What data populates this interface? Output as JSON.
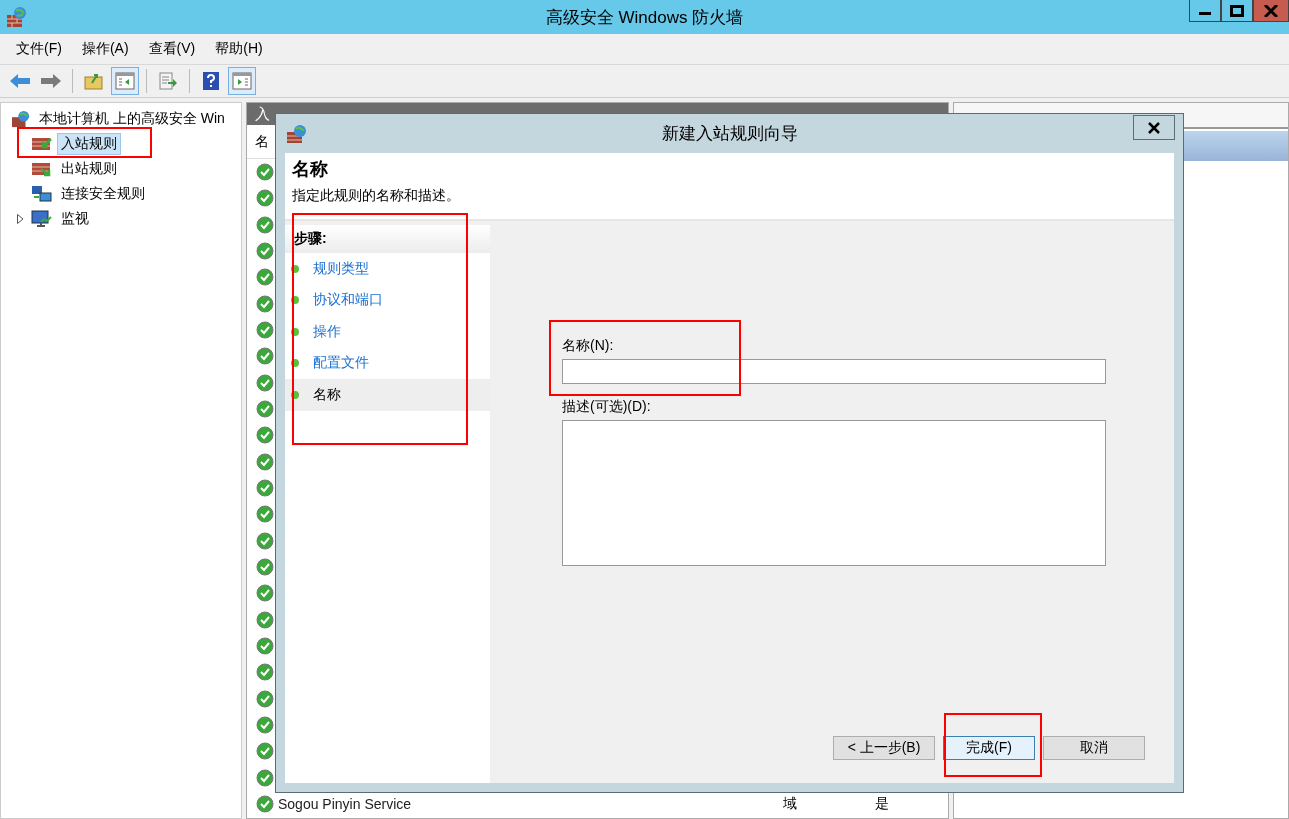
{
  "window": {
    "title": "高级安全 Windows 防火墙"
  },
  "menu": [
    "文件(F)",
    "操作(A)",
    "查看(V)",
    "帮助(H)"
  ],
  "toolbar": [
    {
      "kind": "back",
      "pressed": false
    },
    {
      "kind": "forward",
      "pressed": false
    },
    {
      "kind": "up",
      "pressed": false
    },
    {
      "kind": "tree",
      "pressed": true
    },
    {
      "kind": "export",
      "pressed": false
    },
    {
      "kind": "help",
      "pressed": false
    },
    {
      "kind": "pane",
      "pressed": true
    }
  ],
  "tree": {
    "root": "本地计算机 上的高级安全 Win",
    "children": [
      {
        "label": "入站规则",
        "kind": "inbound",
        "selected": true
      },
      {
        "label": "出站规则",
        "kind": "outbound",
        "selected": false
      },
      {
        "label": "连接安全规则",
        "kind": "security",
        "selected": false
      },
      {
        "label": "监视",
        "kind": "monitor",
        "selected": false,
        "expanded": false
      }
    ]
  },
  "rules": {
    "title": "入",
    "column_1": "名",
    "rows": [
      {
        "name": "Sogou Pinyin Service",
        "column_2": "域",
        "column_3": "是"
      }
    ]
  },
  "dialog": {
    "title": "新建入站规则向导",
    "heading": "名称",
    "subtitle": "指定此规则的名称和描述。",
    "steps_title": "步骤:",
    "steps": [
      {
        "label": "规则类型",
        "selected": false
      },
      {
        "label": "协议和端口",
        "selected": false
      },
      {
        "label": "操作",
        "selected": false
      },
      {
        "label": "配置文件",
        "selected": false
      },
      {
        "label": "名称",
        "selected": true
      }
    ],
    "name_label": "名称(N):",
    "desc_label": "描述(可选)(D):",
    "buttons": [
      {
        "label": "< 上一步(B)",
        "default": false
      },
      {
        "label": "完成(F)",
        "default": true
      },
      {
        "label": "取消",
        "default": false
      }
    ]
  }
}
